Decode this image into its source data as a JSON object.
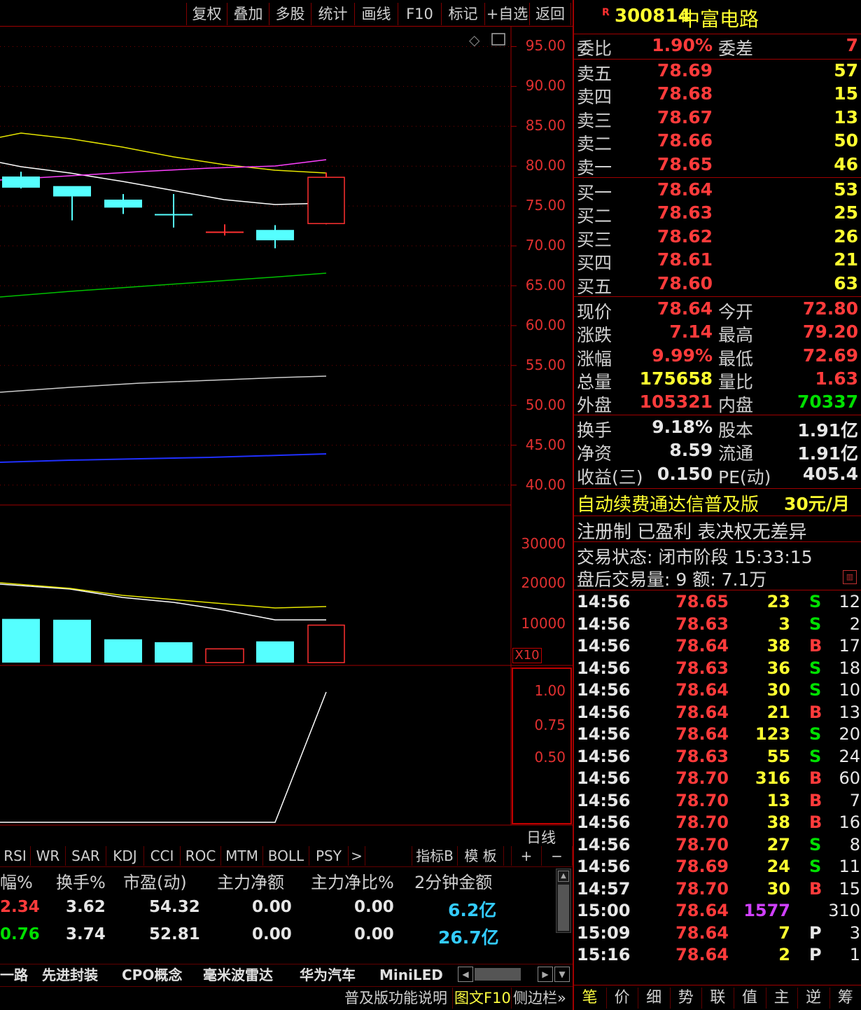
{
  "toolbar": {
    "buttons": [
      "复权",
      "叠加",
      "多股",
      "统计",
      "画线",
      "F10",
      "标记",
      "+自选",
      "返回"
    ]
  },
  "chart": {
    "price_axis": [
      "95.00",
      "90.00",
      "85.00",
      "80.00",
      "75.00",
      "70.00",
      "65.00",
      "60.00",
      "55.00",
      "50.00",
      "45.00",
      "40.00"
    ],
    "volume_axis": [
      "30000",
      "20000",
      "10000"
    ],
    "volume_unit": "X10",
    "indicator_axis": [
      "1.00",
      "0.75",
      "0.50"
    ],
    "period_label": "日线"
  },
  "chart_data": {
    "type": "candlestick",
    "ylim": [
      37.5,
      97.5
    ],
    "candles": [
      {
        "open": 78.7,
        "close": 77.3,
        "high": 79.3,
        "low": 77.2,
        "color": "cyan"
      },
      {
        "open": 77.5,
        "close": 76.2,
        "high": 76.2,
        "low": 73.2,
        "color": "cyan"
      },
      {
        "open": 75.8,
        "close": 74.8,
        "high": 76.5,
        "low": 74.0,
        "color": "cyan"
      },
      {
        "open": 74.0,
        "close": 73.9,
        "high": 76.5,
        "low": 72.3,
        "color": "cyan"
      },
      {
        "open": 71.8,
        "close": 71.7,
        "high": 72.7,
        "low": 71.3,
        "color": "red"
      },
      {
        "open": 72.0,
        "close": 70.7,
        "high": 72.6,
        "low": 69.7,
        "color": "cyan"
      },
      {
        "open": 72.8,
        "close": 78.6,
        "high": 79.2,
        "low": 72.7,
        "color": "red"
      }
    ],
    "volumes": [
      10500,
      10300,
      5600,
      4900,
      3300,
      5100,
      9000
    ],
    "volume_ylim": [
      0,
      35000
    ]
  },
  "indicators": {
    "tabs": [
      "RSI",
      "WR",
      "SAR",
      "KDJ",
      "CCI",
      "ROC",
      "MTM",
      "BOLL",
      "PSY",
      ">"
    ],
    "right_tabs": [
      "指标B",
      "模 板",
      "+",
      "−"
    ]
  },
  "stats_table": {
    "headers": [
      "幅%",
      "换手%",
      "市盈(动)",
      "主力净额",
      "主力净比%",
      "2分钟金额"
    ],
    "rows": [
      [
        "2.34",
        "3.62",
        "54.32",
        "0.00",
        "0.00",
        "6.2亿"
      ],
      [
        "0.76",
        "3.74",
        "52.81",
        "0.00",
        "0.00",
        "26.7亿"
      ]
    ]
  },
  "block_tabs": [
    "一路",
    "先进封装",
    "CPO概念",
    "毫米波雷达",
    "华为汽车",
    "MiniLED"
  ],
  "bottom_bar": [
    "普及版功能说明",
    "图文F10",
    "侧边栏»"
  ],
  "stock": {
    "badge": "R",
    "code": "300814",
    "name": "中富电路",
    "weibi_label": "委比",
    "weibi": "1.90%",
    "weicha_label": "委差",
    "weicha": "7",
    "asks": [
      {
        "label": "卖五",
        "price": "78.69",
        "vol": "57"
      },
      {
        "label": "卖四",
        "price": "78.68",
        "vol": "15"
      },
      {
        "label": "卖三",
        "price": "78.67",
        "vol": "13"
      },
      {
        "label": "卖二",
        "price": "78.66",
        "vol": "50"
      },
      {
        "label": "卖一",
        "price": "78.65",
        "vol": "46"
      }
    ],
    "bids": [
      {
        "label": "买一",
        "price": "78.64",
        "vol": "53"
      },
      {
        "label": "买二",
        "price": "78.63",
        "vol": "25"
      },
      {
        "label": "买三",
        "price": "78.62",
        "vol": "26"
      },
      {
        "label": "买四",
        "price": "78.61",
        "vol": "21"
      },
      {
        "label": "买五",
        "price": "78.60",
        "vol": "63"
      }
    ],
    "quote": [
      {
        "k1": "现价",
        "v1": "78.64",
        "c1": "red",
        "k2": "今开",
        "v2": "72.80",
        "c2": "red"
      },
      {
        "k1": "涨跌",
        "v1": "7.14",
        "c1": "red",
        "k2": "最高",
        "v2": "79.20",
        "c2": "red"
      },
      {
        "k1": "涨幅",
        "v1": "9.99%",
        "c1": "red",
        "k2": "最低",
        "v2": "72.69",
        "c2": "red"
      },
      {
        "k1": "总量",
        "v1": "175658",
        "c1": "yellow",
        "k2": "量比",
        "v2": "1.63",
        "c2": "red"
      },
      {
        "k1": "外盘",
        "v1": "105321",
        "c1": "red",
        "k2": "内盘",
        "v2": "70337",
        "c2": "green"
      }
    ],
    "fund": [
      {
        "k1": "换手",
        "v1": "9.18%",
        "k2": "股本",
        "v2": "1.91亿"
      },
      {
        "k1": "净资",
        "v1": "8.59",
        "k2": "流通",
        "v2": "1.91亿"
      },
      {
        "k1": "收益(三)",
        "v1": "0.150",
        "k2": "PE(动)",
        "v2": "405.4"
      }
    ],
    "ad_text": "自动续费通达信普及版",
    "ad_price": "30元/月",
    "reg_text": "注册制 已盈利 表决权无差异",
    "trade_status": "交易状态: 闭市阶段 15:33:15",
    "after_hours": "盘后交易量: 9  额: 7.1万"
  },
  "ticks": [
    {
      "t": "14:56",
      "p": "78.65",
      "v": "23",
      "d": "S",
      "n": "12"
    },
    {
      "t": "14:56",
      "p": "78.63",
      "v": "3",
      "d": "S",
      "n": "2"
    },
    {
      "t": "14:56",
      "p": "78.64",
      "v": "38",
      "d": "B",
      "n": "17"
    },
    {
      "t": "14:56",
      "p": "78.63",
      "v": "36",
      "d": "S",
      "n": "18"
    },
    {
      "t": "14:56",
      "p": "78.64",
      "v": "30",
      "d": "S",
      "n": "10"
    },
    {
      "t": "14:56",
      "p": "78.64",
      "v": "21",
      "d": "B",
      "n": "13"
    },
    {
      "t": "14:56",
      "p": "78.64",
      "v": "123",
      "d": "S",
      "n": "20"
    },
    {
      "t": "14:56",
      "p": "78.63",
      "v": "55",
      "d": "S",
      "n": "24"
    },
    {
      "t": "14:56",
      "p": "78.70",
      "v": "316",
      "d": "B",
      "n": "60"
    },
    {
      "t": "14:56",
      "p": "78.70",
      "v": "13",
      "d": "B",
      "n": "7"
    },
    {
      "t": "14:56",
      "p": "78.70",
      "v": "38",
      "d": "B",
      "n": "16"
    },
    {
      "t": "14:56",
      "p": "78.70",
      "v": "27",
      "d": "S",
      "n": "8"
    },
    {
      "t": "14:56",
      "p": "78.69",
      "v": "24",
      "d": "S",
      "n": "11"
    },
    {
      "t": "14:57",
      "p": "78.70",
      "v": "30",
      "d": "B",
      "n": "15"
    },
    {
      "t": "15:00",
      "p": "78.64",
      "v": "1577",
      "d": "",
      "n": "310"
    },
    {
      "t": "15:09",
      "p": "78.64",
      "v": "7",
      "d": "P",
      "n": "3"
    },
    {
      "t": "15:16",
      "p": "78.64",
      "v": "2",
      "d": "P",
      "n": "1"
    }
  ],
  "func_tabs": [
    "笔",
    "价",
    "细",
    "势",
    "联",
    "值",
    "主",
    "逆",
    "筹"
  ]
}
